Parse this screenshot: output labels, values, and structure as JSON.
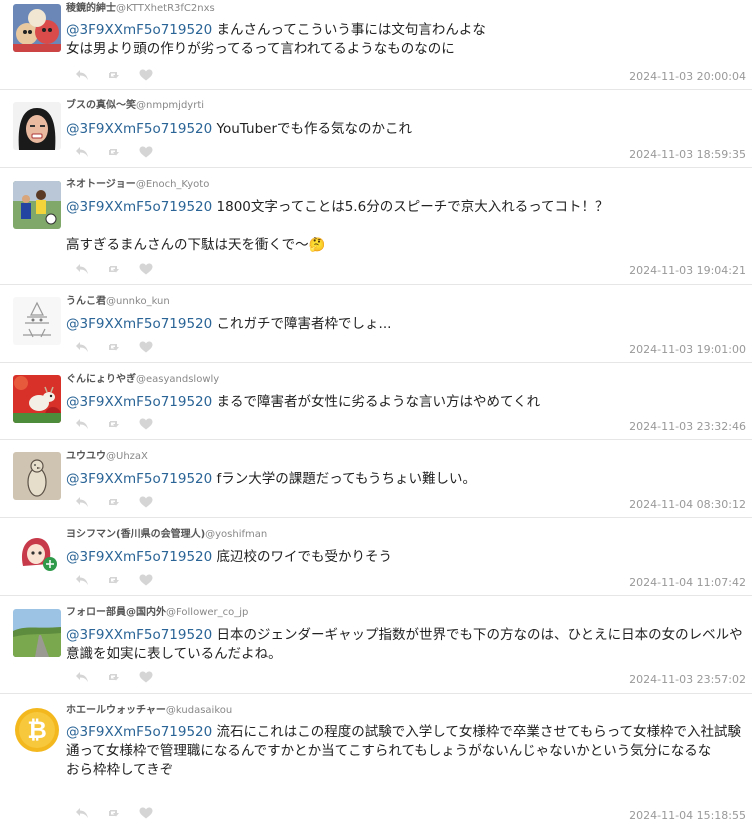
{
  "tweets": [
    {
      "name": "稜鏡的紳士",
      "handle": "@KTTXhetR3fC2nxs",
      "mention": "@3F9XXmF5o719520",
      "text": " まんさんってこういう事には文句言わんよな\n女は男より頭の作りが劣ってるって言われてるようなものなのに",
      "time": "2024-11-03 20:00:04",
      "avatar": "plush-toys"
    },
    {
      "name": "ブスの真似〜笑",
      "handle": "@nmpmjdyrti",
      "mention": "@3F9XXmF5o719520",
      "text": " YouTuberでも作る気なのかこれ",
      "time": "2024-11-03 18:59:35",
      "avatar": "grimace-face"
    },
    {
      "name": "ネオトージョー",
      "handle": "@Enoch_Kyoto",
      "mention": "@3F9XXmF5o719520",
      "text": " 1800文字ってことは5.6分のスピーチで京大入れるってコト！？\n\n高すぎるまんさんの下駄は天を衝くで〜🤔",
      "time": "2024-11-03 19:04:21",
      "avatar": "soccer"
    },
    {
      "name": "うんこ君",
      "handle": "@unnko_kun",
      "mention": "@3F9XXmF5o719520",
      "text": " これガチで障害者枠でしょ...",
      "time": "2024-11-03 19:01:00",
      "avatar": "ascii-art"
    },
    {
      "name": "ぐんにょりやぎ",
      "handle": "@easyandslowly",
      "mention": "@3F9XXmF5o719520",
      "text": " まるで障害者が女性に劣るような言い方はやめてくれ",
      "time": "2024-11-03 23:32:46",
      "avatar": "goat-flowers"
    },
    {
      "name": "ユウユウ",
      "handle": "@UhzaX",
      "mention": "@3F9XXmF5o719520",
      "text": " fラン大学の課題だってもうちょい難しい。",
      "time": "2024-11-04 08:30:12",
      "avatar": "penguin-sketch"
    },
    {
      "name": "ヨシフマン(香川県の会管理人)",
      "handle": "@yoshifman",
      "mention": "@3F9XXmF5o719520",
      "text": " 底辺校のワイでも受かりそう",
      "time": "2024-11-04 11:07:42",
      "avatar": "anime-girl"
    },
    {
      "name": "フォロー部員@国内外",
      "handle": "@Follower_co_jp",
      "mention": "@3F9XXmF5o719520",
      "text": " 日本のジェンダーギャップ指数が世界でも下の方なのは、ひとえに日本の女のレベルや意識を如実に表しているんだよね。",
      "time": "2024-11-03 23:57:02",
      "avatar": "road-landscape"
    },
    {
      "name": "ホエールウォッチャー",
      "handle": "@kudasaikou",
      "mention": "@3F9XXmF5o719520",
      "text": " 流石にこれはこの程度の試験で入学して女様枠で卒業させてもらって女様枠で入社試験通って女様枠で管理職になるんですかとか当てこすられてもしょうがないんじゃないかという気分になるな\nおら枠枠してきぞ",
      "time": "2024-11-04 15:18:55",
      "avatar": "bitcoin"
    }
  ]
}
